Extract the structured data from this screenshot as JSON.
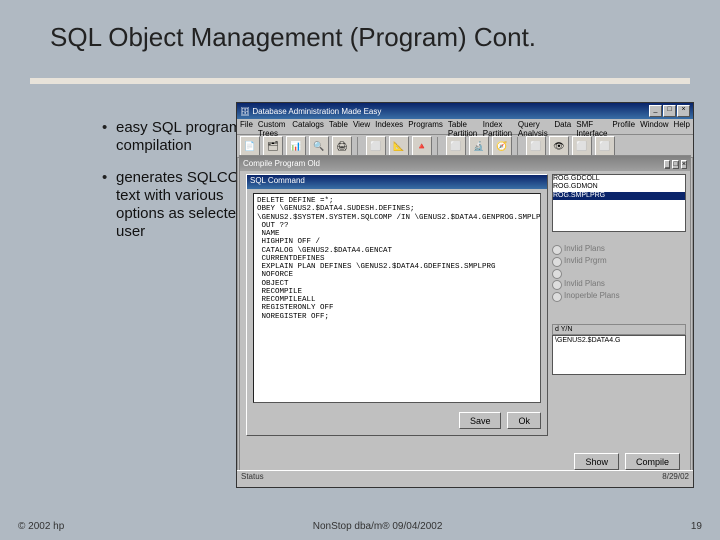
{
  "slide": {
    "title": "SQL Object Management (Program) Cont.",
    "bullets": [
      "easy SQL program compilation",
      "generates SQLCOMP text with various options as selected by user"
    ]
  },
  "app": {
    "window_title": "Database Administration Made Easy",
    "menu": [
      "File",
      "Custom Trees",
      "Catalogs",
      "Table",
      "View",
      "Indexes",
      "Programs",
      "Table Partition",
      "Index Partition",
      "Query Analysis",
      "Data",
      "SMF Interface",
      "Profile",
      "Window",
      "Help"
    ],
    "toolbar_icons": [
      "📄",
      "🗂",
      "📊",
      "🔍",
      "🖨",
      "⬜",
      "📐",
      "🔺",
      "⬜",
      "🔬",
      "🧭",
      "⬜",
      "👁",
      "⬜",
      "⬜"
    ],
    "status_left": "Status",
    "status_right": "8/29/02"
  },
  "compile_win": {
    "title": "Compile Program Old"
  },
  "sql_win": {
    "title": "SQL Command",
    "text": "DELETE DEFINE =*;\nOBEY \\GENUS2.$DATA4.SUDESH.DEFINES;\n\\GENUS2.$SYSTEM.SYSTEM.SQLCOMP /IN \\GENUS2.$DATA4.GENPROG.SMPLPRG/\n OUT ??\n NAME\n HIGHPIN OFF /\n CATALOG \\GENUS2.$DATA4.GENCAT\n CURRENTDEFINES\n EXPLAIN PLAN DEFINES \\GENUS2.$DATA4.GDEFINES.SMPLPRG\n NOFORCE\n OBJECT\n RECOMPILE\n RECOMPILEALL\n REGISTERONLY OFF\n NOREGISTER OFF;",
    "save_btn": "Save",
    "ok_btn": "Ok"
  },
  "right": {
    "programs": [
      "ROG.GDCOLL",
      "ROG.GDMON",
      "ROG.SMPLPRG"
    ],
    "radios": [
      "Invlid Plans",
      "Invlid Prgrm",
      "Invlid Plans",
      "Inoperble Plans"
    ],
    "table_head": "d Y/N",
    "table_val": "\\GENUS2.$DATA4.G",
    "show_btn": "Show",
    "compile_btn": "Compile"
  },
  "footer": {
    "left": "© 2002 hp",
    "center": "NonStop dba/m® 09/04/2002",
    "right": "19"
  }
}
